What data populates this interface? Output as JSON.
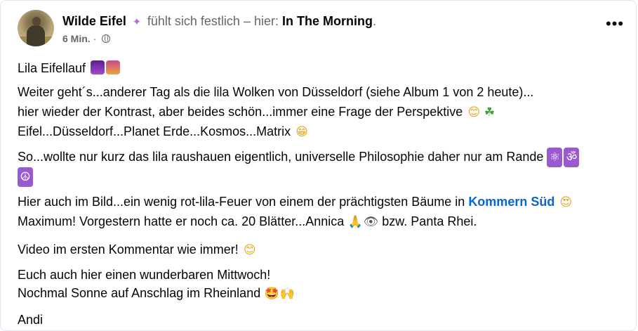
{
  "post": {
    "author": "Wilde Eifel",
    "feeling_text": "fühlt sich festlich – hier:",
    "place": "In The Morning",
    "period": ".",
    "time": "6 Min.",
    "separator": "·",
    "more_label": "•••"
  },
  "icons": {
    "avatar": "avatar-photo",
    "feeling": "confetti-icon",
    "audience": "globe-icon",
    "more": "more-options-icon"
  },
  "content": {
    "line1": "Lila Eifellauf",
    "line2": "Weiter geht´s...anderer Tag als die lila Wolken von Düsseldorf (siehe Album 1 von 2 heute)...",
    "line3": "hier wieder der Kontrast, aber beides schön...immer eine Frage der Perspektive",
    "line4": "Eifel...Düsseldorf...Planet Erde...Kosmos...Matrix",
    "line5": "So...wollte nur kurz das lila raushauen eigentlich, universelle Philosophie daher nur am Rande",
    "line7a": "Hier auch im Bild...ein wenig rot-lila-Feuer von einem der prächtigsten Bäume in",
    "line7_link": "Kommern Süd",
    "line8a": "Maximum! Vorgestern hatte er noch ca. 20 Blätter...Annica",
    "line8b": "bzw. Panta Rhei.",
    "line9": "Video im ersten Kommentar wie immer!",
    "line10": "Euch auch hier einen wunderbaren Mittwoch!",
    "line11": "Nochmal Sonne auf Anschlag im Rheinland",
    "line12": "Andi"
  },
  "emojis": {
    "e_purple_square": "purple-sky-emoji",
    "e_sunrise": "sunrise-emoji",
    "e_smile": "😊",
    "e_clover": "☘",
    "e_grin": "😁",
    "e_atom": "⚛",
    "e_om": "ॐ",
    "e_peace": "☮",
    "e_heart_eyes": "😍",
    "e_pray": "🙏",
    "e_eye": "👁",
    "e_smile2": "😊",
    "e_star_struck": "🤩",
    "e_raised_hands": "🙌"
  },
  "colors": {
    "link": "#0a64d0",
    "muted": "#65676b",
    "text": "#050505",
    "purple_emoji": "#7d3bb3",
    "sunrise_emoji": "#f3a33b"
  }
}
